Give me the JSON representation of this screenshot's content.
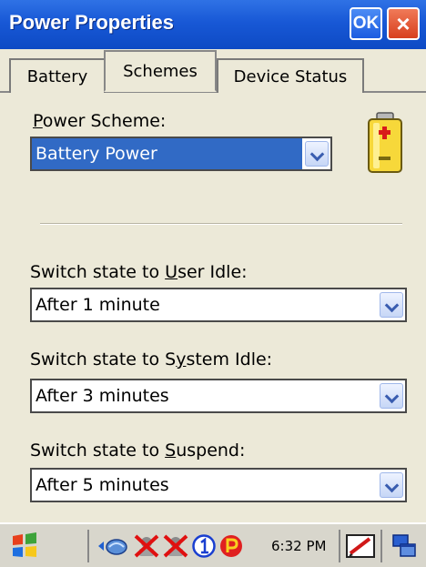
{
  "window": {
    "title": "Power Properties",
    "ok_label": "OK",
    "close_label": "×"
  },
  "tabs": [
    {
      "label": "Battery",
      "active": false
    },
    {
      "label": "Schemes",
      "active": true
    },
    {
      "label": "Device Status",
      "active": false
    }
  ],
  "scheme": {
    "label": "Power Scheme:",
    "value": "Battery Power"
  },
  "user_idle": {
    "label": "Switch state to User Idle:",
    "value": "After 1 minute"
  },
  "system_idle": {
    "label": "Switch state to System Idle:",
    "value": "After 3 minutes"
  },
  "suspend": {
    "label": "Switch state to Suspend:",
    "value": "After 5 minutes"
  },
  "taskbar": {
    "clock": "6:32 PM",
    "tray_icons": [
      "network-icon",
      "disconnected-icon",
      "disconnected-icon",
      "info-icon",
      "parking-icon"
    ]
  },
  "colors": {
    "titlebar": "#1858d6",
    "selection": "#316ac5",
    "window_bg": "#ece9d8"
  }
}
